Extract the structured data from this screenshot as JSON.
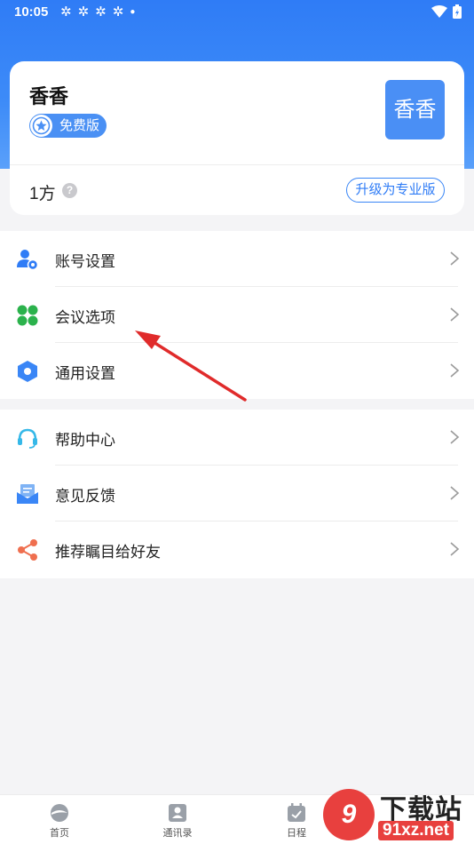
{
  "status_bar": {
    "time": "10:05"
  },
  "profile": {
    "name": "香香",
    "plan": "免费版",
    "avatar_text": "香香",
    "quota": "1方",
    "help_glyph": "?",
    "upgrade_label": "升级为专业版"
  },
  "menu_group_1": [
    {
      "label": "账号设置",
      "icon": "user-settings-icon"
    },
    {
      "label": "会议选项",
      "icon": "clover-icon"
    },
    {
      "label": "通用设置",
      "icon": "hexagon-gear-icon"
    }
  ],
  "menu_group_2": [
    {
      "label": "帮助中心",
      "icon": "headset-icon"
    },
    {
      "label": "意见反馈",
      "icon": "feedback-mail-icon"
    },
    {
      "label": "推荐瞩目给好友",
      "icon": "share-icon"
    }
  ],
  "tabs": [
    {
      "label": "首页"
    },
    {
      "label": "通讯录"
    },
    {
      "label": "日程"
    }
  ],
  "watermark": {
    "badge": "9",
    "title": "下载站",
    "url": "91xz.net"
  },
  "colors": {
    "brand": "#2f7cf6",
    "green": "#2bb24c",
    "orange": "#ef6f4f",
    "cyan": "#35b8e8"
  }
}
